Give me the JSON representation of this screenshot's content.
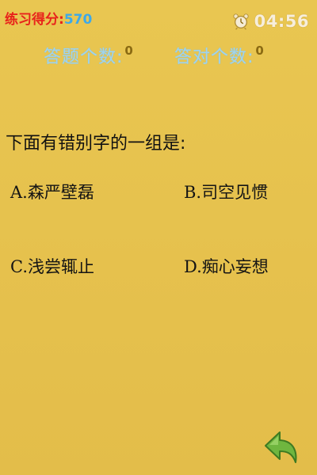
{
  "header": {
    "score_label": "练习得分:",
    "score_value": "570",
    "timer": "04:56"
  },
  "counters": {
    "answered_label": "答题个数:",
    "answered_value": "0",
    "correct_label": "答对个数:",
    "correct_value": "0"
  },
  "question": {
    "text": "下面有错别字的一组是:",
    "options": [
      {
        "label": "A.森严壁磊"
      },
      {
        "label": "B.司空见惯"
      },
      {
        "label": "C.浅尝辄止"
      },
      {
        "label": "D.痴心妄想"
      }
    ]
  },
  "icons": {
    "timer": "alarm-clock-icon",
    "back": "back-arrow-icon"
  },
  "colors": {
    "background": "#e6c24e",
    "score_label": "#e8231b",
    "score_value": "#3da9e9",
    "counter_label": "#9fd4ef",
    "back_arrow": "#6fb63f"
  }
}
